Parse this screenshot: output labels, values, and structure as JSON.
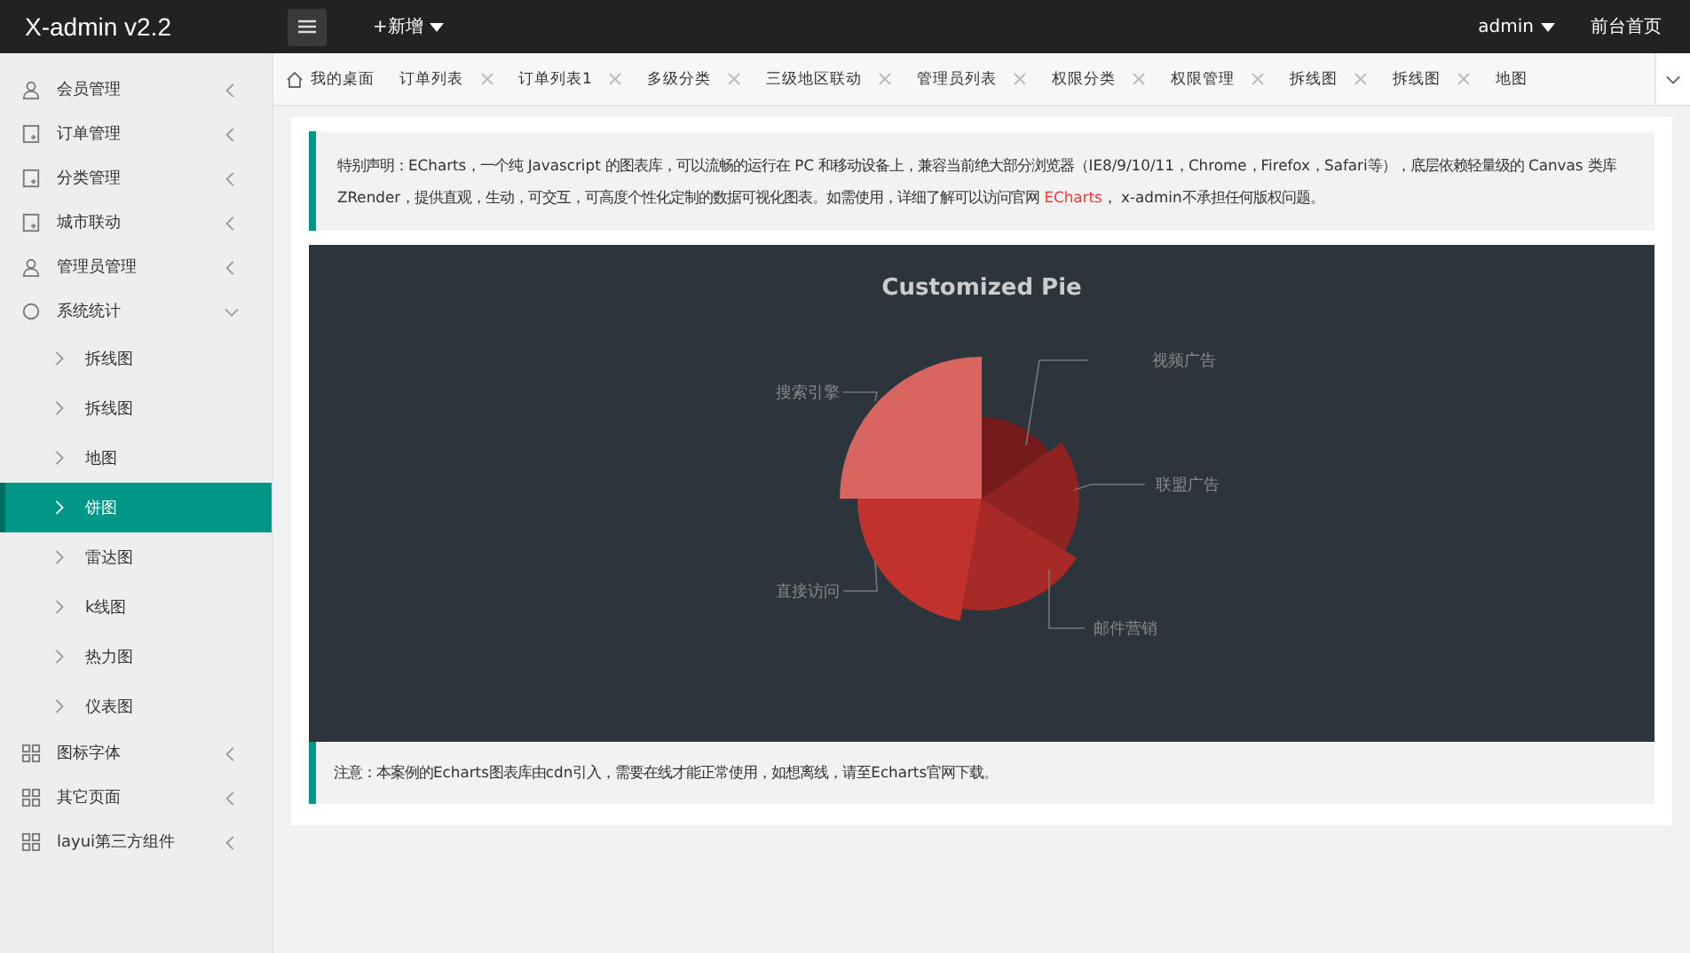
{
  "header": {
    "logo": "X-admin v2.2",
    "add_menu": "+新增",
    "user": "admin",
    "front_link": "前台首页"
  },
  "sidebar": {
    "items": [
      {
        "label": "会员管理",
        "kind": "user",
        "expanded": false
      },
      {
        "label": "订单管理",
        "kind": "doc",
        "expanded": false
      },
      {
        "label": "分类管理",
        "kind": "doc",
        "expanded": false
      },
      {
        "label": "城市联动",
        "kind": "doc",
        "expanded": false
      },
      {
        "label": "管理员管理",
        "kind": "user",
        "expanded": false
      },
      {
        "label": "系统统计",
        "kind": "circle",
        "expanded": true,
        "children": [
          {
            "label": "拆线图",
            "selected": false
          },
          {
            "label": "拆线图",
            "selected": false
          },
          {
            "label": "地图",
            "selected": false
          },
          {
            "label": "饼图",
            "selected": true
          },
          {
            "label": "雷达图",
            "selected": false
          },
          {
            "label": "k线图",
            "selected": false
          },
          {
            "label": "热力图",
            "selected": false
          },
          {
            "label": "仪表图",
            "selected": false
          }
        ]
      },
      {
        "label": "图标字体",
        "kind": "grid",
        "expanded": false
      },
      {
        "label": "其它页面",
        "kind": "grid",
        "expanded": false
      },
      {
        "label": "layui第三方组件",
        "kind": "grid",
        "expanded": false
      }
    ]
  },
  "tabs": [
    {
      "label": "我的桌面",
      "kind": "home"
    },
    {
      "label": "订单列表",
      "kind": "closable"
    },
    {
      "label": "订单列表1",
      "kind": "closable"
    },
    {
      "label": "多级分类",
      "kind": "closable"
    },
    {
      "label": "三级地区联动",
      "kind": "closable"
    },
    {
      "label": "管理员列表",
      "kind": "closable"
    },
    {
      "label": "权限分类",
      "kind": "closable"
    },
    {
      "label": "权限管理",
      "kind": "closable"
    },
    {
      "label": "拆线图",
      "kind": "closable"
    },
    {
      "label": "拆线图",
      "kind": "closable"
    },
    {
      "label": "地图",
      "kind": "cut"
    }
  ],
  "notice": {
    "before": "特别声明：ECharts，一个纯 Javascript 的图表库，可以流畅的运行在 PC 和移动设备上，兼容当前绝大部分浏览器（IE8/9/10/11，Chrome，Firefox，Safari等），底层依赖轻量级的 Canvas 类库 ZRender，提供直观，生动，可交互，可高度个性化定制的数据可视化图表。如需使用，详细了解可以访问官网 ",
    "link": "ECharts",
    "after": "， x-admin不承担任何版权问题。"
  },
  "pie": {
    "title": "Customized Pie",
    "slices": [
      {
        "label": "视频广告",
        "color": "#761b1b"
      },
      {
        "label": "联盟广告",
        "color": "#8e2321"
      },
      {
        "label": "邮件营销",
        "color": "#a72a26"
      },
      {
        "label": "直接访问",
        "color": "#c1322d"
      },
      {
        "label": "搜索引擎",
        "color": "#d8665f"
      }
    ]
  },
  "note": "注意：本案例的Echarts图表库由cdn引入，需要在线才能正常使用，如想离线，请至Echarts官网下载。"
}
